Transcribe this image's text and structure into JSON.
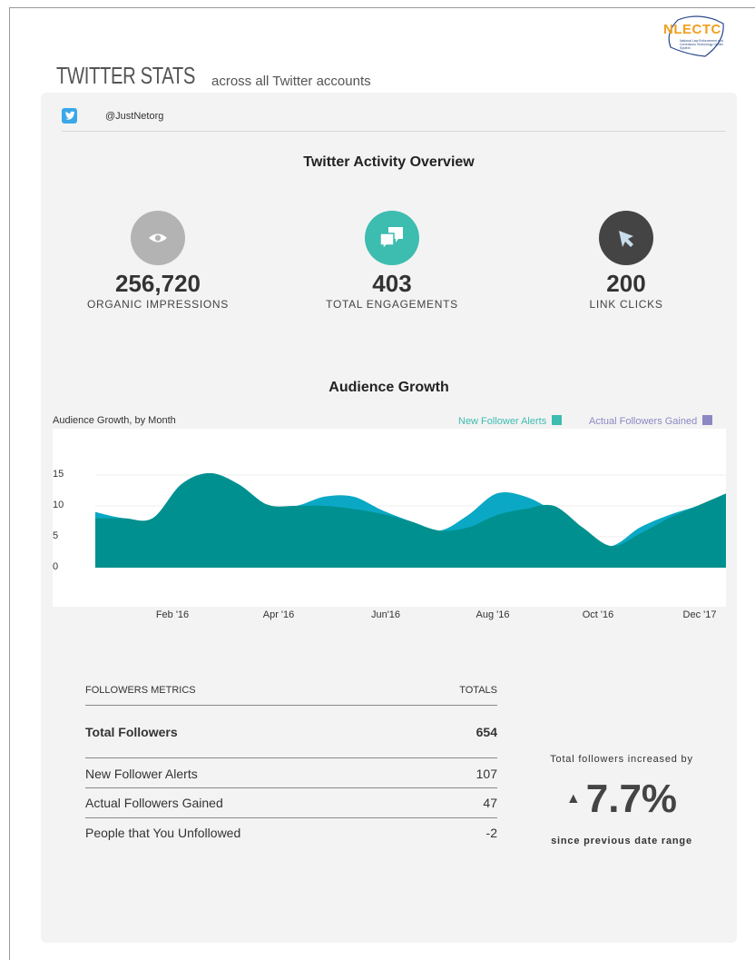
{
  "header": {
    "logo_text": "NLECTC",
    "logo_subtext": "National Law Enforcement and Corrections Technology Center System",
    "title_big": "TWITTER STATS",
    "title_small": "across all Twitter accounts"
  },
  "account": {
    "icon": "twitter-bird-icon",
    "handle": "@JustNetorg"
  },
  "overview": {
    "title": "Twitter Activity Overview",
    "kpis": [
      {
        "value": "256,720",
        "label": "ORGANIC IMPRESSIONS",
        "icon": "eye-icon",
        "color": "#b3b3b3"
      },
      {
        "value": "403",
        "label": "TOTAL ENGAGEMENTS",
        "icon": "chat-bubbles-icon",
        "color": "#3dbcb0"
      },
      {
        "value": "200",
        "label": "LINK CLICKS",
        "icon": "cursor-icon",
        "color": "#444444"
      }
    ]
  },
  "growth": {
    "title": "Audience Growth",
    "chart_label": "Audience Growth, by Month",
    "legend": [
      {
        "label": "New Follower Alerts",
        "color": "#3dbcb0"
      },
      {
        "label": "Actual Followers Gained",
        "color": "#8c88c4"
      }
    ]
  },
  "chart_data": {
    "type": "area",
    "title": "Audience Growth, by Month",
    "x_ticks": [
      "Feb '16",
      "Apr '16",
      "Jun'16",
      "Aug '16",
      "Oct '16",
      "Dec '17"
    ],
    "y_ticks": [
      "0",
      "5",
      "10",
      "15"
    ],
    "ylim": [
      0,
      15
    ],
    "grid": true,
    "legend_position": "top-right",
    "series": [
      {
        "name": "New Follower Alerts",
        "color": "#0aa8c4",
        "values": [
          9,
          8,
          8,
          13.5,
          15.3,
          13.5,
          10.2,
          10,
          11.5,
          11.5,
          9.3,
          7.5,
          6,
          8.5,
          12,
          11.5,
          9,
          5,
          3.5,
          6.5,
          8.5,
          10,
          12
        ]
      },
      {
        "name": "Actual Followers Gained",
        "color": "#00908f",
        "values": [
          8,
          8,
          8,
          13.5,
          15.3,
          13.5,
          10.2,
          10,
          10,
          9.5,
          8.7,
          7.5,
          6,
          6.5,
          8.5,
          9.5,
          10,
          6.5,
          3.5,
          5.5,
          8,
          10,
          12
        ]
      }
    ]
  },
  "metrics": {
    "header_left": "FOLLOWERS METRICS",
    "header_right": "TOTALS",
    "total_label": "Total Followers",
    "total_value": "654",
    "rows": [
      {
        "label": "New Follower Alerts",
        "value": "107"
      },
      {
        "label": "Actual Followers Gained",
        "value": "47"
      },
      {
        "label": "People that You Unfollowed",
        "value": "-2"
      }
    ]
  },
  "summary": {
    "top": "Total followers increased by",
    "arrow": "▲",
    "percent": "7.7%",
    "bottom": "since previous date range"
  }
}
